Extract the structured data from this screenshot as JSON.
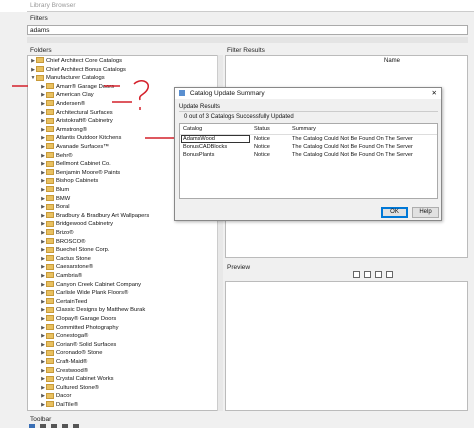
{
  "window": {
    "title": "Library Browser"
  },
  "filters": {
    "label": "Filters",
    "value": "adams"
  },
  "folders": {
    "label": "Folders",
    "items": [
      {
        "label": "Chief Architect Core Catalogs",
        "level": 0,
        "expanded": false
      },
      {
        "label": "Chief Architect Bonus Catalogs",
        "level": 0,
        "expanded": false
      },
      {
        "label": "Manufacturer Catalogs",
        "level": 0,
        "expanded": true
      },
      {
        "label": "Amarr® Garage Doors",
        "level": 1
      },
      {
        "label": "American Clay",
        "level": 1
      },
      {
        "label": "Andersen®",
        "level": 1
      },
      {
        "label": "Architectural Surfaces",
        "level": 1
      },
      {
        "label": "Aristokraft® Cabinetry",
        "level": 1
      },
      {
        "label": "Armstrong®",
        "level": 1
      },
      {
        "label": "Atlantis Outdoor Kitchens",
        "level": 1
      },
      {
        "label": "Avanade Surfaces™",
        "level": 1
      },
      {
        "label": "Behr®",
        "level": 1
      },
      {
        "label": "Bellmont Cabinet Co.",
        "level": 1
      },
      {
        "label": "Benjamin Moore® Paints",
        "level": 1
      },
      {
        "label": "Bishop Cabinets",
        "level": 1
      },
      {
        "label": "Blum",
        "level": 1
      },
      {
        "label": "BMW",
        "level": 1
      },
      {
        "label": "Boral",
        "level": 1
      },
      {
        "label": "Bradbury & Bradbury Art Wallpapers",
        "level": 1
      },
      {
        "label": "Bridgewood Cabinetry",
        "level": 1
      },
      {
        "label": "Brizo®",
        "level": 1
      },
      {
        "label": "BROSCO®",
        "level": 1
      },
      {
        "label": "Buechel Stone Corp.",
        "level": 1
      },
      {
        "label": "Cactus Stone",
        "level": 1
      },
      {
        "label": "Caesarstone®",
        "level": 1
      },
      {
        "label": "Cambria®",
        "level": 1
      },
      {
        "label": "Canyon Creek Cabinet Company",
        "level": 1
      },
      {
        "label": "Carlisle Wide Plank Floors®",
        "level": 1
      },
      {
        "label": "CertainTeed",
        "level": 1
      },
      {
        "label": "Classic Designs by Matthew Burak",
        "level": 1
      },
      {
        "label": "Clopay® Garage Doors",
        "level": 1
      },
      {
        "label": "Committed Photography",
        "level": 1
      },
      {
        "label": "Conestoga®",
        "level": 1
      },
      {
        "label": "Corian® Solid Surfaces",
        "level": 1
      },
      {
        "label": "Coronado® Stone",
        "level": 1
      },
      {
        "label": "Craft-Maid®",
        "level": 1
      },
      {
        "label": "Crestwood®",
        "level": 1
      },
      {
        "label": "Crystal Cabinet Works",
        "level": 1
      },
      {
        "label": "Cultured Stone®",
        "level": 1
      },
      {
        "label": "Dacor",
        "level": 1
      },
      {
        "label": "DalTile®",
        "level": 1
      }
    ]
  },
  "filter_results": {
    "label": "Filter Results",
    "column": "Name"
  },
  "preview": {
    "label": "Preview"
  },
  "toolbar": {
    "label": "Toolbar"
  },
  "dialog": {
    "title": "Catalog Update Summary",
    "group_label": "Update Results",
    "summary": "0 out of 3 Catalogs Successfully Updated",
    "columns": [
      "Catalog",
      "Status",
      "Summary"
    ],
    "rows": [
      {
        "catalog": "AdamsWood",
        "status": "Notice",
        "summary": "The Catalog Could Not Be Found On The Server"
      },
      {
        "catalog": "BonusCADBlocks",
        "status": "Notice",
        "summary": "The Catalog Could Not Be Found On The Server"
      },
      {
        "catalog": "BonusPlants",
        "status": "Notice",
        "summary": "The Catalog Could Not Be Found On The Server"
      }
    ],
    "ok_label": "OK",
    "help_label": "Help",
    "close_glyph": "✕"
  },
  "annotation": {
    "text": "?",
    "color": "#d4202a"
  }
}
